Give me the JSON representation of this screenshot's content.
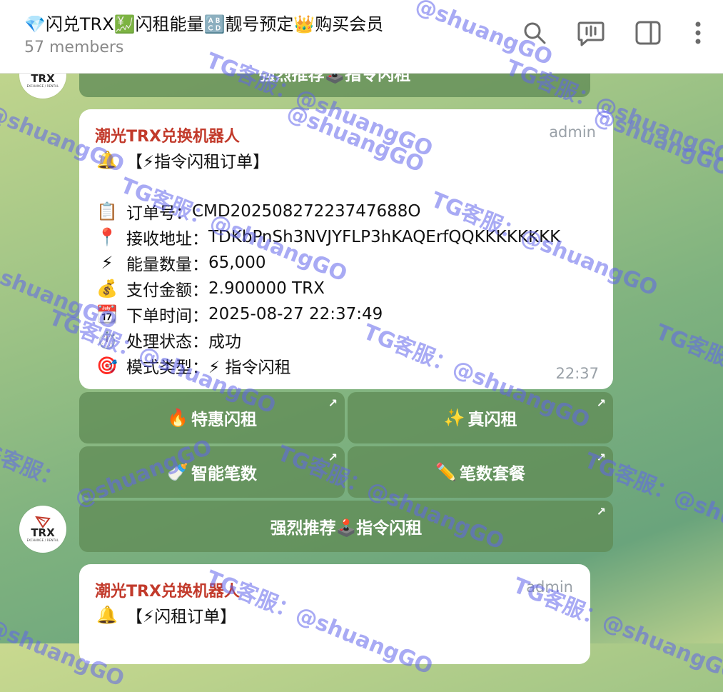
{
  "header": {
    "title": "💎闪兑TRX💹闪租能量🔠靓号预定👑购买会员",
    "subtitle": "57 members"
  },
  "avatar": {
    "logo_text": "TRX",
    "logo_sub": "EXCHANGE / RENTAL"
  },
  "prev_button": {
    "label": "强烈推荐🕹️指令闪租"
  },
  "message1": {
    "sender": "潮光TRX兑换机器人",
    "role": "admin",
    "heading": "【⚡指令闪租订单】",
    "heading_emoji": "🔔",
    "fields": [
      {
        "emoji": "📋",
        "label": "订单号：",
        "value": "CMD20250827223747688O"
      },
      {
        "emoji": "📍",
        "label": "接收地址：",
        "value": "TDKbPnSh3NVJYFLP3hKAQErfQQKKKKKKKK"
      },
      {
        "emoji": "⚡",
        "label": "能量数量：",
        "value": "65,000"
      },
      {
        "emoji": "💰",
        "label": "支付金额：",
        "value": "2.900000 TRX"
      },
      {
        "emoji": "📆",
        "label": "下单时间：",
        "value": "2025-08-27 22:37:49"
      },
      {
        "emoji": "⏱️",
        "label": "处理状态：",
        "value": "成功"
      },
      {
        "emoji": "🎯",
        "label": "模式类型：",
        "value": "⚡ 指令闪租"
      }
    ],
    "time": "22:37"
  },
  "keyboard": [
    {
      "emoji": "🔥",
      "label": "特惠闪租",
      "arrow": "↗"
    },
    {
      "emoji": "✨",
      "label": "真闪租",
      "arrow": "↗"
    },
    {
      "emoji": "🍼",
      "label": "智能笔数",
      "arrow": "↗"
    },
    {
      "emoji": "✏️",
      "label": "笔数套餐",
      "arrow": "↗"
    },
    {
      "emoji": "",
      "label": "强烈推荐🕹️指令闪租",
      "arrow": "↗"
    }
  ],
  "message2": {
    "sender": "潮光TRX兑换机器人",
    "role": "admin",
    "heading_emoji": "🔔",
    "heading": "【⚡闪租订单】"
  },
  "watermark": {
    "text_a": "TG客服：@shuangGO",
    "text_b": "@shuangGO",
    "text_c": "TG客服："
  },
  "colors": {
    "sender": "#c23a2b",
    "button_bg": "#6b9a5e",
    "watermark": "#6064eb",
    "header_bg": "#ffffff"
  }
}
